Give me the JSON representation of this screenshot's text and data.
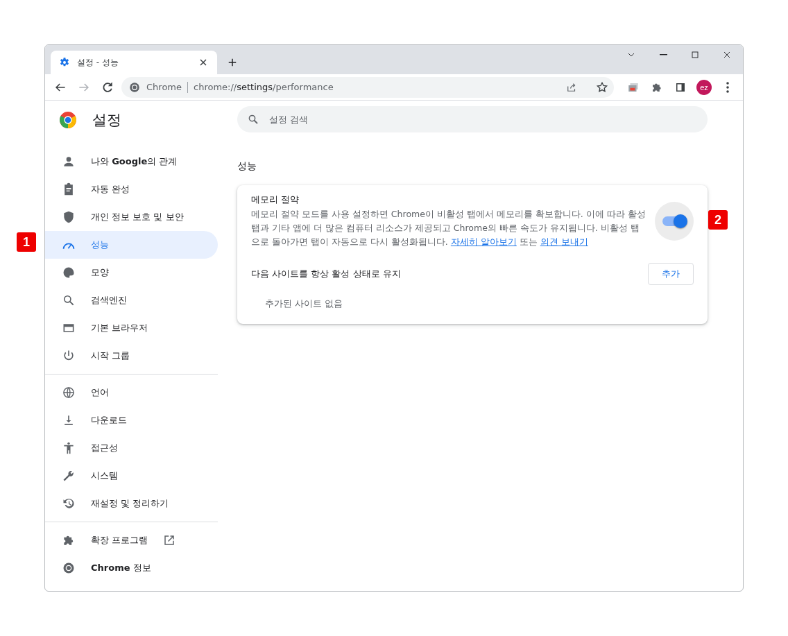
{
  "browser": {
    "tab": {
      "title": "설정 - 성능",
      "selected": true
    },
    "omnibox": {
      "site": "Chrome",
      "url_prefix": "chrome://",
      "url_path": "settings",
      "url_suffix": "/performance"
    },
    "profile": "ez"
  },
  "sidebar": {
    "title": "설정",
    "groups": [
      {
        "items": [
          {
            "label": "나와 **Google**의 관계",
            "selected": false
          },
          {
            "label": "자동 완성",
            "selected": false
          },
          {
            "label": "개인 정보 보호 및 보안",
            "selected": false
          },
          {
            "label": "성능",
            "selected": true
          },
          {
            "label": "모양",
            "selected": false
          },
          {
            "label": "검색엔진",
            "selected": false
          },
          {
            "label": "기본 브라우저",
            "selected": false
          },
          {
            "label": "시작 그룹",
            "selected": false
          }
        ]
      },
      {
        "items": [
          {
            "label": "언어",
            "selected": false
          },
          {
            "label": "다운로드",
            "selected": false
          },
          {
            "label": "접근성",
            "selected": false
          },
          {
            "label": "시스템",
            "selected": false
          },
          {
            "label": "재설정 및 정리하기",
            "selected": false
          }
        ]
      },
      {
        "items": [
          {
            "label": "확장 프로그램",
            "selected": false
          },
          {
            "label": "**Chrome** 정보",
            "selected": false
          }
        ]
      }
    ]
  },
  "search": {
    "placeholder": "설정 검색"
  },
  "section": {
    "title": "성능",
    "card": {
      "title": "메모리 절약",
      "on": true,
      "description": [
        {
          "kind": "text",
          "text": "메모리 절약 모드를 사용 설정하면 Chrome이 비활성 탭에서 메모리를 확보합니다. 이에 따라 활성 탭과 기타 앱에 더 많은 컴퓨터 리소스가 제공되고 Chrome의 빠른 속도가 유지됩니다. 비활성 탭으로 돌아가면 탭이 자동으로 다시 활성화됩니다. "
        },
        {
          "kind": "link",
          "text": "자세히 알아보기"
        },
        {
          "kind": "text",
          "text": " 또는 "
        },
        {
          "kind": "link",
          "text": "의견 보내기"
        }
      ],
      "keep_active_label": "다음 사이트를 항상 활성 상태로 유지",
      "add_button": "추가",
      "empty_text": "추가된 사이트 없음"
    }
  },
  "annotations": [
    "1",
    "2"
  ]
}
